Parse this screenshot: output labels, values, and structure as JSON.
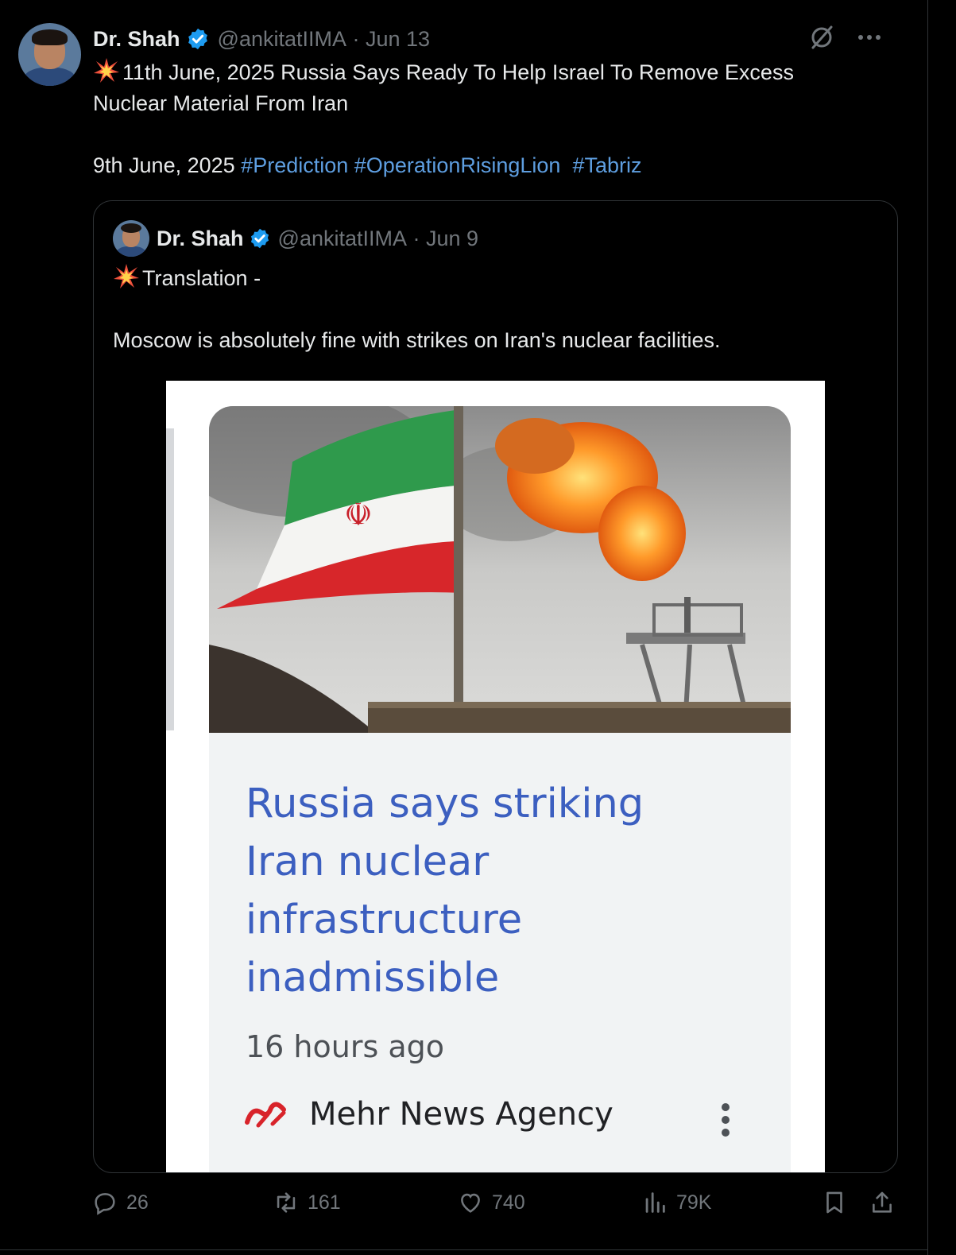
{
  "tweet": {
    "author_name": "Dr. Shah",
    "handle": "@ankitatIIMA",
    "date": "Jun 13",
    "text_line1": "11th June, 2025 Russia Says Ready To Help Israel To Remove Excess",
    "text_line2": "Nuclear Material From Iran",
    "date_prefix": "9th June, 2025",
    "hashtags": [
      "#Prediction",
      "#OperationRisingLion",
      "#Tabriz"
    ]
  },
  "quoted_tweet": {
    "author_name": "Dr. Shah",
    "handle": "@ankitatIIMA",
    "date": "Jun 9",
    "text_line1": "Translation -",
    "text_line2": "Moscow is absolutely fine with strikes on Iran's nuclear facilities."
  },
  "news_card": {
    "headline_lines": [
      "Russia says striking",
      "Iran nuclear",
      "infrastructure",
      "inadmissible"
    ],
    "time": "16 hours ago",
    "source": "Mehr News Agency"
  },
  "actions": {
    "replies": "26",
    "reposts": "161",
    "likes": "740",
    "views": "79K"
  },
  "icons": [
    "verified-badge-icon",
    "grok-icon",
    "more-icon",
    "collision-emoji-icon",
    "reply-icon",
    "repost-icon",
    "like-icon",
    "views-icon",
    "bookmark-icon",
    "share-icon",
    "kebab-menu-icon",
    "mehr-logo"
  ],
  "colors": {
    "background": "#000000",
    "text": "#e7e9ea",
    "muted": "#71767b",
    "link": "#5e9ee0",
    "verified": "#1d9bf0",
    "headline": "#3c5fc0"
  }
}
